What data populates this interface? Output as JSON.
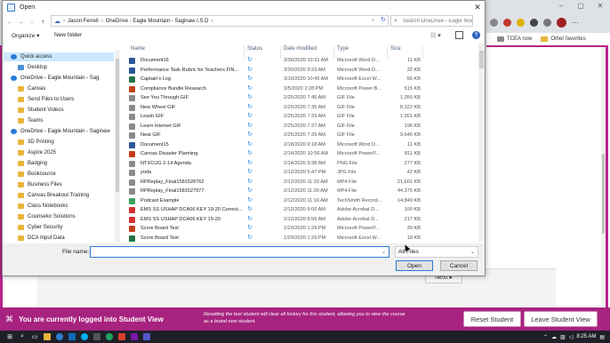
{
  "background": {
    "bookmarks": [
      {
        "label": "TCEA now"
      },
      {
        "label": "Other favorites"
      }
    ],
    "next_label": "Next ▸"
  },
  "student_view": {
    "message": "You are currently logged into Student View",
    "note": "Resetting the test student will clear all history for this student, allowing you to view the course as a brand new student.",
    "reset_label": "Reset Student",
    "leave_label": "Leave Student View",
    "color": "#a7237f"
  },
  "taskbar": {
    "time": "8:25 AM"
  },
  "dialog": {
    "title": "Open",
    "path": [
      "Jason Ferrell",
      "OneDrive - Eagle Mountain - Saginaw I.S.D"
    ],
    "search_placeholder": "Search OneDrive - Eagle Mou...",
    "organize_label": "Organize ▾",
    "new_folder_label": "New folder",
    "help": "?",
    "nav_items": [
      {
        "label": "Quick access",
        "icon": "star-icon",
        "selected": true
      },
      {
        "label": "Desktop",
        "icon": "desktop-icon"
      },
      {
        "label": "OneDrive - Eagle Mountain - Sag",
        "icon": "cloud-icon"
      },
      {
        "label": "Canvas",
        "icon": "folder-icon"
      },
      {
        "label": "Send Files to Users",
        "icon": "folder-icon"
      },
      {
        "label": "Student Videos",
        "icon": "folder-icon"
      },
      {
        "label": "Teams",
        "icon": "folder-icon"
      },
      {
        "label": "OneDrive - Eagle Mountain - Saginaw",
        "icon": "cloud-icon"
      },
      {
        "label": "3D Printing",
        "icon": "folder-icon"
      },
      {
        "label": "Aspire 2025",
        "icon": "folder-icon"
      },
      {
        "label": "Badging",
        "icon": "folder-icon"
      },
      {
        "label": "Booksource",
        "icon": "folder-icon"
      },
      {
        "label": "Business Files",
        "icon": "folder-icon"
      },
      {
        "label": "Canvas Breakout Training",
        "icon": "folder-icon"
      },
      {
        "label": "Class Notebooks",
        "icon": "folder-icon"
      },
      {
        "label": "Counselor Solutions",
        "icon": "folder-icon"
      },
      {
        "label": "Cyber Security",
        "icon": "folder-icon"
      },
      {
        "label": "DCA Input Data",
        "icon": "folder-icon"
      }
    ],
    "columns": {
      "name": "Name",
      "status": "Status",
      "date": "Date modified",
      "type": "Type",
      "size": "Size"
    },
    "files": [
      {
        "name": "Document16",
        "date": "3/30/2020 10:31 AM",
        "type": "Microsoft Word D...",
        "size": "11 KB",
        "color": "#2b579a"
      },
      {
        "name": "Performance Task Rubric for Teachers FIN...",
        "date": "3/30/2020 9:23 AM",
        "type": "Microsoft Word D...",
        "size": "32 KB",
        "color": "#2b579a"
      },
      {
        "name": "Captain's Log",
        "date": "3/10/2020 10:45 AM",
        "type": "Microsoft Excel W...",
        "size": "66 KB",
        "color": "#217346"
      },
      {
        "name": "Compliance Bundle Research",
        "date": "3/5/2020 2:28 PM",
        "type": "Microsoft Power B...",
        "size": "515 KB",
        "color": "#c43e1c"
      },
      {
        "name": "See You Through GIF",
        "date": "2/25/2020 7:45 AM",
        "type": "GIF File",
        "size": "1,355 KB",
        "color": "#8a8a8a"
      },
      {
        "name": "New Wheel GIF",
        "date": "2/25/2020 7:35 AM",
        "type": "GIF File",
        "size": "8,322 KB",
        "color": "#8a8a8a"
      },
      {
        "name": "Leash GIF",
        "date": "2/25/2020 7:29 AM",
        "type": "GIF File",
        "size": "1,951 KB",
        "color": "#8a8a8a"
      },
      {
        "name": "Learn Internet GIF",
        "date": "2/25/2020 7:27 AM",
        "type": "GIF File",
        "size": "196 KB",
        "color": "#8a8a8a"
      },
      {
        "name": "Neat GIF",
        "date": "2/25/2020 7:25 AM",
        "type": "GIF File",
        "size": "9,646 KB",
        "color": "#8a8a8a"
      },
      {
        "name": "Document15",
        "date": "2/18/2020 9:18 AM",
        "type": "Microsoft Word D...",
        "size": "11 KB",
        "color": "#2b579a"
      },
      {
        "name": "Canvas Disaster Planning",
        "date": "2/14/2020 10:56 AM",
        "type": "Microsoft PowerP...",
        "size": "811 KB",
        "color": "#c43e1c"
      },
      {
        "name": "NTXCUG 2-14 Agenda",
        "date": "2/14/2020 9:38 AM",
        "type": "PNG File",
        "size": "277 KB",
        "color": "#8a8a8a"
      },
      {
        "name": "yoda",
        "date": "2/12/2020 5:47 PM",
        "type": "JPG File",
        "size": "42 KB",
        "color": "#8a8a8a"
      },
      {
        "name": "RPReplay_Final1581528762",
        "date": "2/12/2020 11:33 AM",
        "type": "MP4 File",
        "size": "21,601 KB",
        "color": "#8a8a8a"
      },
      {
        "name": "RPReplay_Final1581527977",
        "date": "2/12/2020 11:20 AM",
        "type": "MP4 File",
        "size": "44,375 KB",
        "color": "#8a8a8a"
      },
      {
        "name": "Podcast Example",
        "date": "2/12/2020 11:16 AM",
        "type": "TechSmith Record...",
        "size": "14,849 KB",
        "color": "#3aa15c"
      },
      {
        "name": "EMS SS USHAP DCA06 KEY 19-20 Correct...",
        "date": "2/12/2020 9:00 AM",
        "type": "Adobe Acrobat D...",
        "size": "100 KB",
        "color": "#d32f2f"
      },
      {
        "name": "EMS SS USHAP DCA06 KEY 19-20",
        "date": "2/12/2020 8:56 AM",
        "type": "Adobe Acrobat D...",
        "size": "217 KB",
        "color": "#d32f2f"
      },
      {
        "name": "Score Board Test",
        "date": "1/29/2020 1:29 PM",
        "type": "Microsoft PowerP...",
        "size": "39 KB",
        "color": "#c43e1c"
      },
      {
        "name": "Score Board Test",
        "date": "1/29/2020 1:29 PM",
        "type": "Microsoft Excel W...",
        "size": "18 KB",
        "color": "#217346"
      }
    ],
    "filename_label": "File name:",
    "filename_value": "",
    "filter_value": "All Files",
    "open_label": "Open",
    "cancel_label": "Cancel"
  }
}
